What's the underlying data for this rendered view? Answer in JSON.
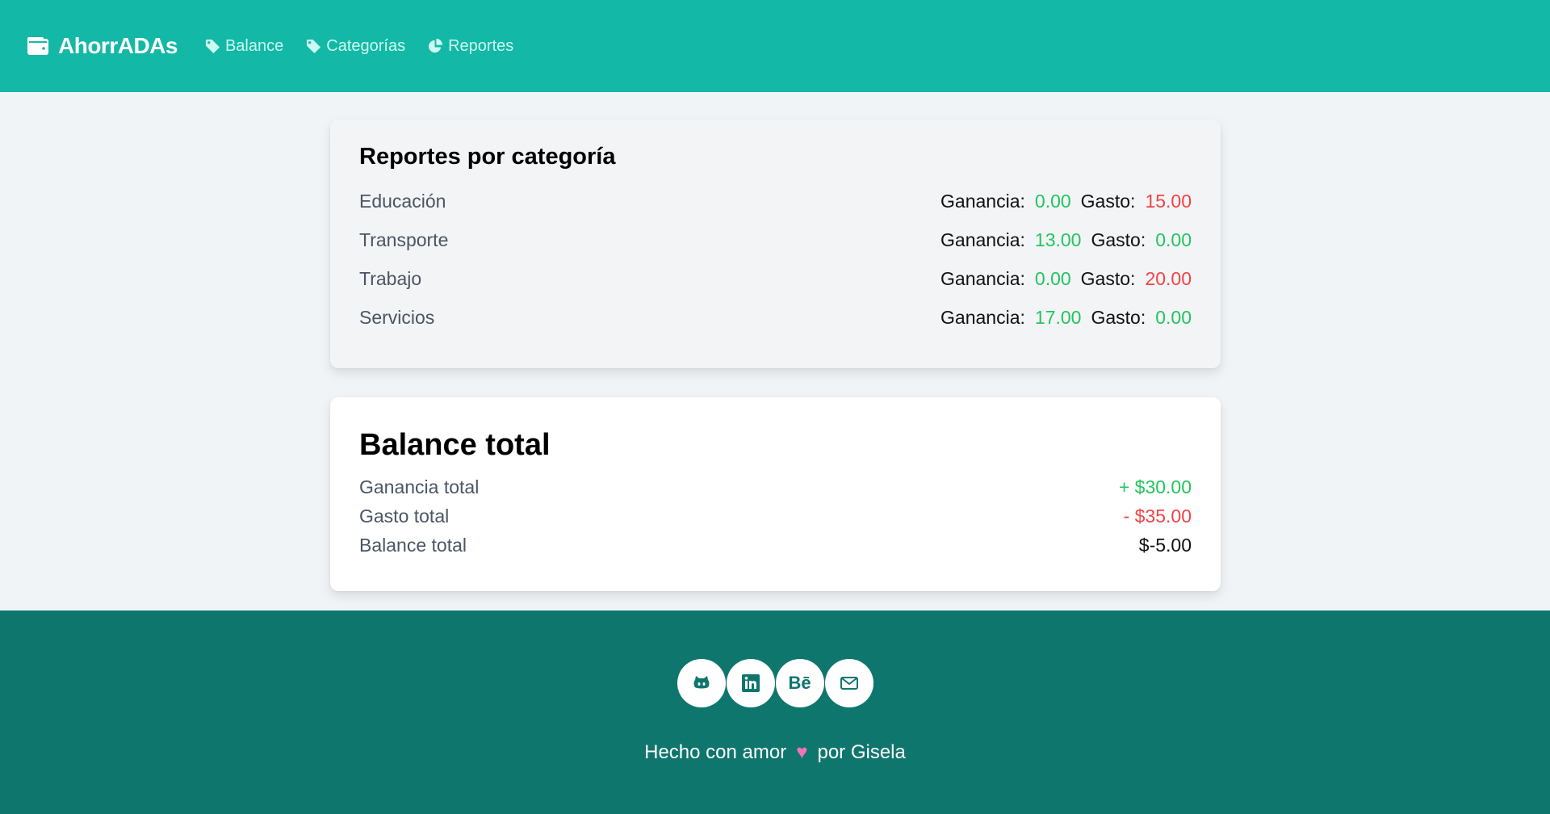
{
  "nav": {
    "brand": "AhorrADAs",
    "items": [
      {
        "label": "Balance",
        "icon": "tag-icon"
      },
      {
        "label": "Categorías",
        "icon": "tag-icon"
      },
      {
        "label": "Reportes",
        "icon": "pie-chart-icon"
      }
    ]
  },
  "reports": {
    "title": "Reportes por categoría",
    "gain_label": "Ganancia:",
    "expense_label": "Gasto:",
    "rows": [
      {
        "category": "Educación",
        "gain": "0.00",
        "expense": "15.00"
      },
      {
        "category": "Transporte",
        "gain": "13.00",
        "expense": "0.00"
      },
      {
        "category": "Trabajo",
        "gain": "0.00",
        "expense": "20.00"
      },
      {
        "category": "Servicios",
        "gain": "17.00",
        "expense": "0.00"
      }
    ]
  },
  "balance": {
    "title": "Balance total",
    "rows": [
      {
        "label": "Ganancia total",
        "value": "+ $30.00"
      },
      {
        "label": "Gasto total",
        "value": "- $35.00"
      },
      {
        "label": "Balance total",
        "value": "$-5.00"
      }
    ]
  },
  "footer": {
    "socials": [
      "github-icon",
      "linkedin-icon",
      "behance-icon",
      "mail-icon"
    ],
    "behance_text": "Bē",
    "text_before": "Hecho con amor",
    "heart": "♥",
    "text_after": "por Gisela"
  },
  "colors": {
    "primary": "#14b8a6",
    "footer": "#0f766e",
    "positive": "#22c55e",
    "negative": "#ef4444"
  }
}
